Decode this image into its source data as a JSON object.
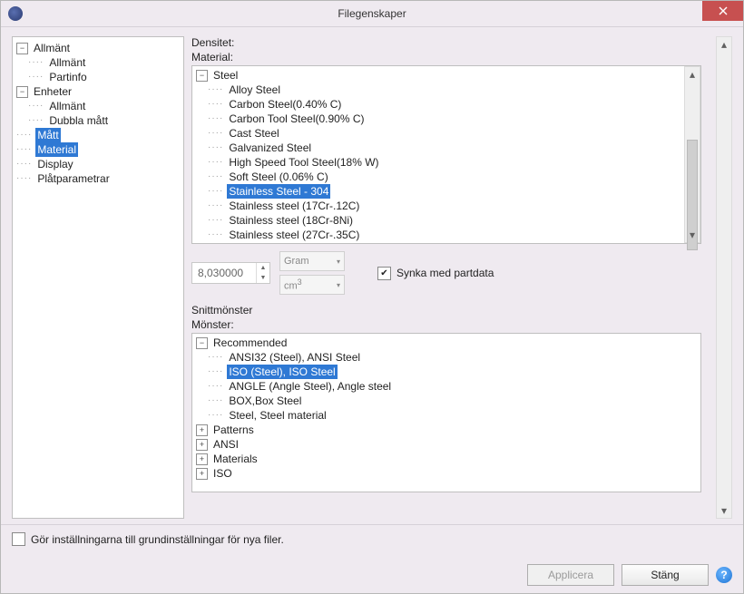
{
  "window": {
    "title": "Filegenskaper"
  },
  "nav": {
    "allmant": "Allmänt",
    "allmant_child": "Allmänt",
    "partinfo": "Partinfo",
    "enheter": "Enheter",
    "enheter_allmant": "Allmänt",
    "dubbla": "Dubbla mått",
    "matt": "Mått",
    "material": "Material",
    "display": "Display",
    "platparam": "Plåtparametrar"
  },
  "labels": {
    "densitet": "Densitet:",
    "material": "Material:",
    "snittmonster": "Snittmönster",
    "monster": "Mönster:"
  },
  "materials": {
    "root": "Steel",
    "items": [
      "Alloy Steel",
      "Carbon Steel(0.40% C)",
      "Carbon Tool Steel(0.90% C)",
      "Cast Steel",
      "Galvanized Steel",
      "High Speed Tool Steel(18% W)",
      "Soft Steel (0.06% C)",
      "Stainless Steel - 304",
      "Stainless steel (17Cr-.12C)",
      "Stainless steel (18Cr-8Ni)",
      "Stainless steel (27Cr-.35C)"
    ],
    "selected_index": 7
  },
  "density": {
    "value": "8,030000",
    "mass_unit": "Gram",
    "vol_unit_base": "cm",
    "vol_unit_exp": "3"
  },
  "sync": {
    "checked": true,
    "label": "Synka med partdata"
  },
  "patterns": {
    "recommended": "Recommended",
    "items": [
      "ANSI32 (Steel), ANSI Steel",
      "ISO (Steel), ISO Steel",
      "ANGLE (Angle Steel), Angle steel",
      "BOX,Box Steel",
      "Steel, Steel material"
    ],
    "selected_index": 1,
    "groups": [
      "Patterns",
      "ANSI",
      "Materials",
      "ISO"
    ]
  },
  "footer": {
    "default_checkbox": "Gör inställningarna till grundinställningar för nya filer.",
    "apply": "Applicera",
    "close": "Stäng"
  }
}
